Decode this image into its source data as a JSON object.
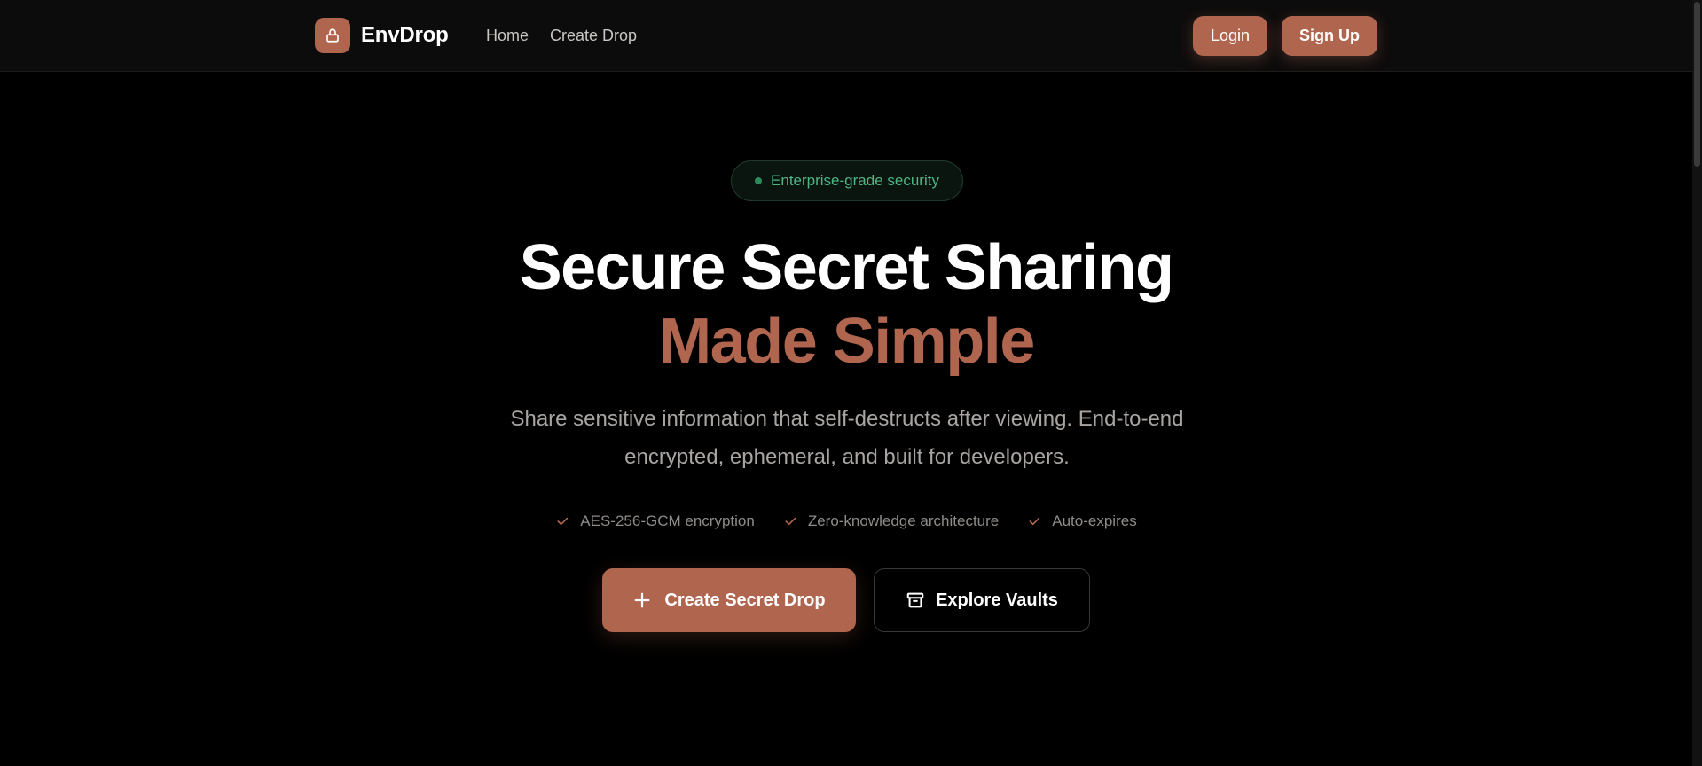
{
  "nav": {
    "brand": "EnvDrop",
    "brand_icon": "lock-icon",
    "links": [
      "Home",
      "Create Drop"
    ],
    "login": "Login",
    "signup": "Sign Up"
  },
  "hero": {
    "badge": "Enterprise-grade security",
    "title_line1": "Secure Secret Sharing",
    "title_line2": "Made Simple",
    "subtitle": "Share sensitive information that self-destructs after viewing. End-to-end encrypted, ephemeral, and built for developers.",
    "features": [
      "AES-256-GCM encryption",
      "Zero-knowledge architecture",
      "Auto-expires"
    ],
    "primary_cta": "Create Secret Drop",
    "primary_icon": "plus-icon",
    "secondary_cta": "Explore Vaults",
    "secondary_icon": "archive-icon"
  },
  "colors": {
    "accent": "#b0654f",
    "background": "#000000",
    "navbar": "#0d0c0c",
    "badge_green": "#4fb583"
  }
}
